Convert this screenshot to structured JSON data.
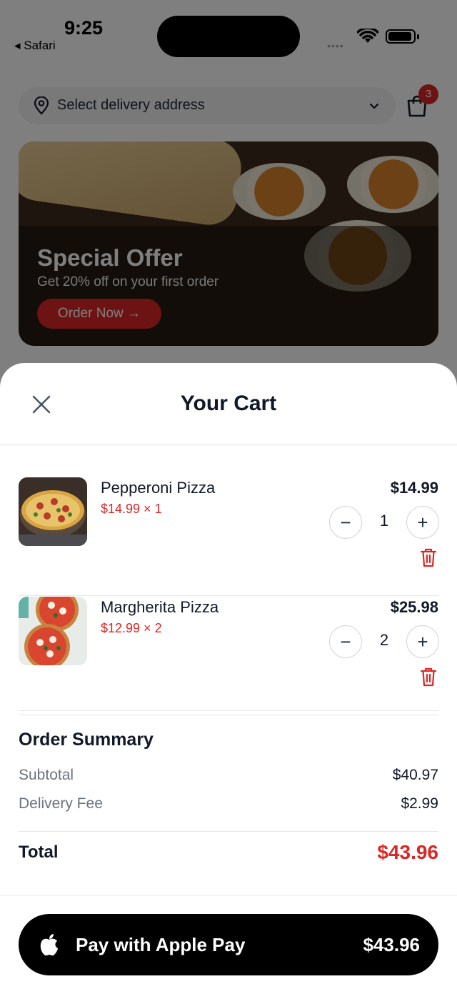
{
  "status": {
    "time": "9:25",
    "back_app": "◂ Safari",
    "signal_dots": "••••"
  },
  "header": {
    "address_placeholder": "Select delivery address",
    "cart_count": "3"
  },
  "banner": {
    "title": "Special Offer",
    "subtitle": "Get 20% off on your first order",
    "cta": "Order Now →"
  },
  "cart": {
    "title": "Your Cart",
    "items": [
      {
        "name": "Pepperoni Pizza",
        "unit": "$14.99 × 1",
        "price": "$14.99",
        "qty": "1"
      },
      {
        "name": "Margherita Pizza",
        "unit": "$12.99 × 2",
        "price": "$25.98",
        "qty": "2"
      }
    ],
    "qty_minus": "−",
    "qty_plus": "+"
  },
  "summary": {
    "title": "Order Summary",
    "subtotal_label": "Subtotal",
    "subtotal": "$40.97",
    "delivery_label": "Delivery Fee",
    "delivery": "$2.99",
    "total_label": "Total",
    "total": "$43.96"
  },
  "pay": {
    "label": "Pay with Apple Pay",
    "amount": "$43.96"
  },
  "colors": {
    "accent": "#dc2626",
    "dark": "#111827",
    "muted": "#6b7280"
  },
  "icons": [
    "location-pin-icon",
    "chevron-down-icon",
    "shopping-bag-icon",
    "close-icon",
    "minus-icon",
    "plus-icon",
    "trash-icon",
    "apple-icon"
  ]
}
